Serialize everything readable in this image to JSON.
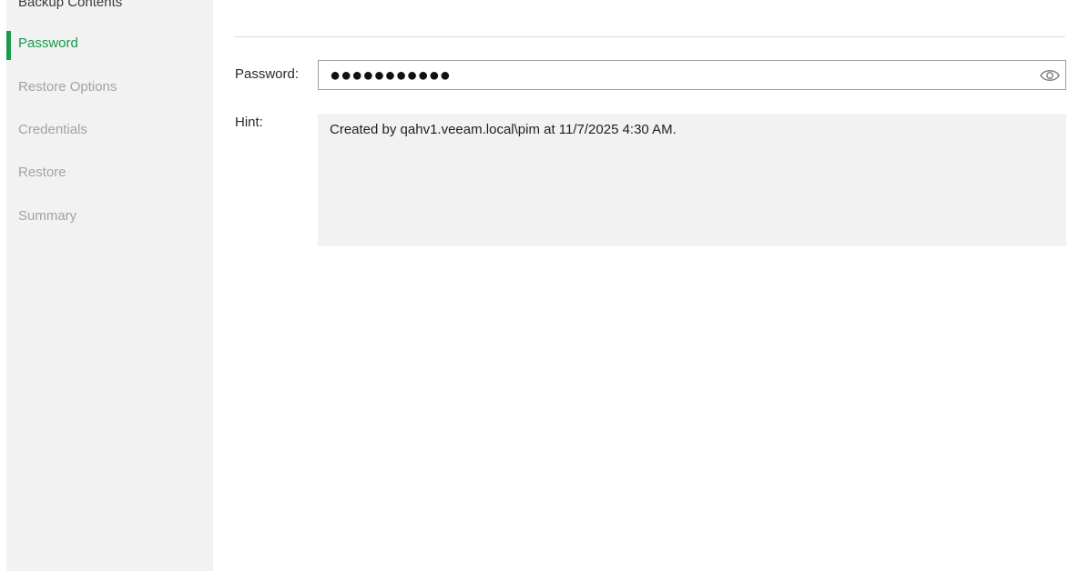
{
  "sidebar": {
    "items": [
      {
        "label": "Backup Contents",
        "state": "done"
      },
      {
        "label": "Password",
        "state": "active"
      },
      {
        "label": "Restore Options",
        "state": "pending"
      },
      {
        "label": "Credentials",
        "state": "pending"
      },
      {
        "label": "Restore",
        "state": "pending"
      },
      {
        "label": "Summary",
        "state": "pending"
      }
    ]
  },
  "form": {
    "password_label": "Password:",
    "password_masked": "●●●●●●●●●●●",
    "hint_label": "Hint:",
    "hint_text": "Created by qahv1.veeam.local\\pim at 11/7/2025 4:30 AM."
  },
  "colors": {
    "accent": "#139a4a",
    "sidebar_bg": "#f2f2f2",
    "hint_bg": "#f2f2f2"
  },
  "icons": {
    "reveal_password": "eye-icon"
  }
}
